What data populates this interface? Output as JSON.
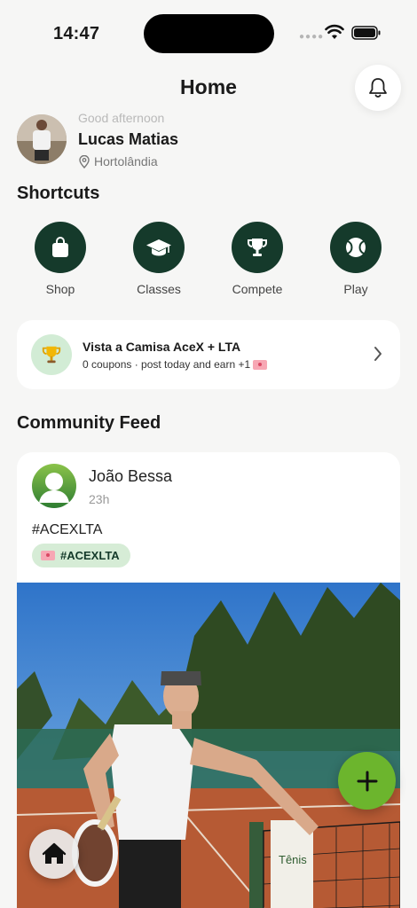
{
  "status_bar": {
    "time": "14:47"
  },
  "header": {
    "title": "Home"
  },
  "profile": {
    "greeting": "Good afternoon",
    "name": "Lucas Matias",
    "location": "Hortolândia"
  },
  "shortcuts": {
    "title": "Shortcuts",
    "items": [
      {
        "label": "Shop",
        "icon": "shopping-bag-icon"
      },
      {
        "label": "Classes",
        "icon": "graduation-cap-icon"
      },
      {
        "label": "Compete",
        "icon": "trophy-icon"
      },
      {
        "label": "Play",
        "icon": "tennis-ball-icon"
      }
    ]
  },
  "promo": {
    "title": "Vista a Camisa AceX + LTA",
    "subtitle": "0 coupons · post today and earn +1",
    "icon": "trophy-emoji"
  },
  "feed": {
    "title": "Community Feed",
    "post": {
      "author": "João Bessa",
      "time": "23h",
      "text": "#ACEXLTA",
      "hashtag": "#ACEXLTA",
      "banner_text": "Tênis"
    }
  },
  "colors": {
    "primary_dark_green": "#153a2b",
    "accent_green": "#6cb52d",
    "chip_green": "#d6ecd6",
    "background": "#f6f6f5"
  }
}
